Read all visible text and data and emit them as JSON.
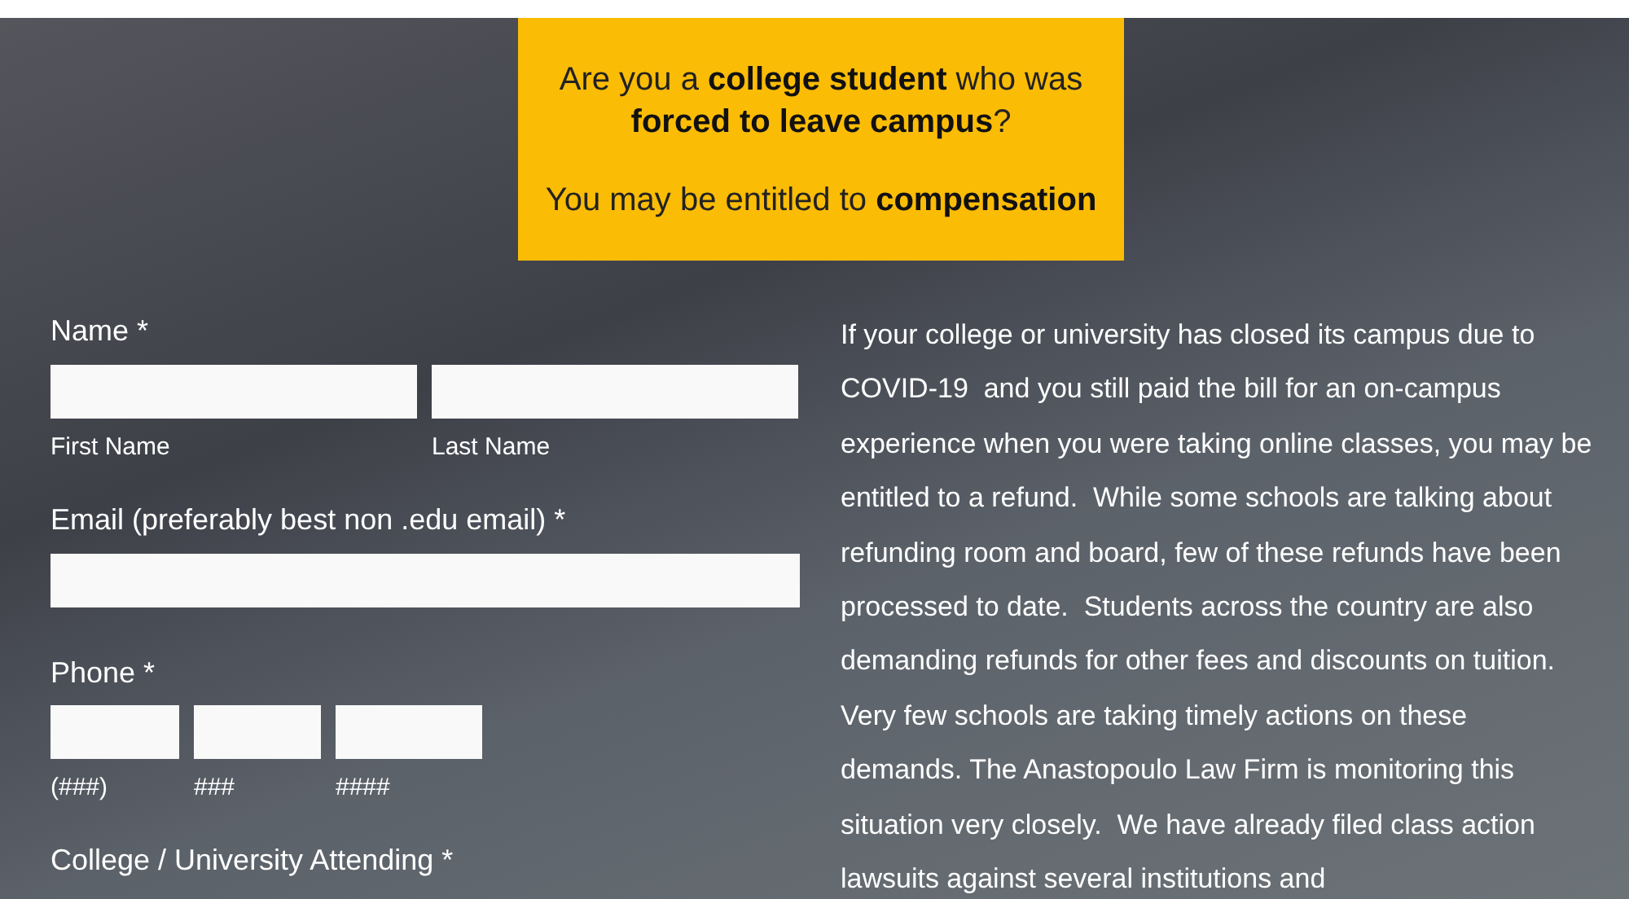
{
  "banner": {
    "question": "Are you a **college student** who was **forced to leave campus**?",
    "offer": "You may be entitled to **compensation**"
  },
  "form": {
    "name": {
      "label": "Name *",
      "first_label": "First Name",
      "last_label": "Last Name"
    },
    "email": {
      "label": "Email (preferably best non .edu email) *"
    },
    "phone": {
      "label": "Phone *",
      "parts": [
        "(###)",
        "###",
        "####"
      ]
    },
    "college": {
      "label": "College / University Attending *"
    }
  },
  "intro": "If your college or university has closed its campus due to COVID-19  and you still paid the bill for an on-campus experience when you were taking online classes, you may be entitled to a refund.  While some schools are talking about refunding room and board, few of these refunds have been processed to date.  Students across the country are also demanding refunds for other fees and discounts on tuition.  Very few schools are taking timely actions on these demands. The Anastopoulo Law Firm is monitoring this situation very closely.  We have already filed class action lawsuits against several institutions and"
}
